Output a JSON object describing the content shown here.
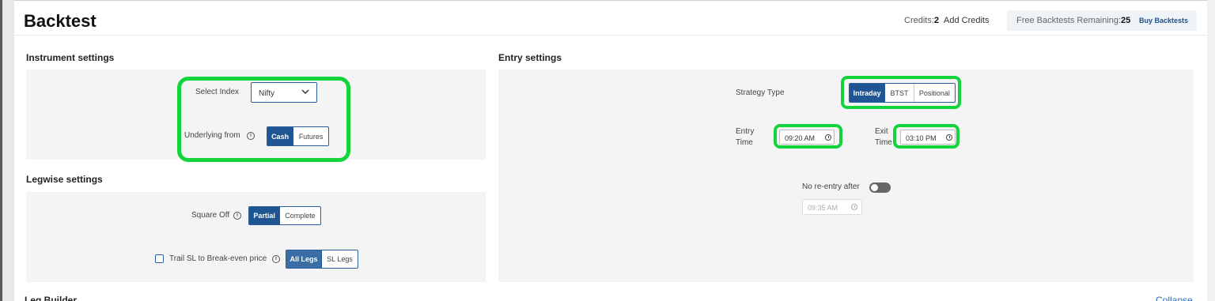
{
  "header": {
    "title": "Backtest",
    "credits_label": "Credits:",
    "credits_value": "2",
    "add_credits": "Add Credits",
    "free_backtests_label": "Free Backtests Remaining:",
    "free_backtests_count": "25",
    "buy_backtests": "Buy Backtests"
  },
  "instrument": {
    "section_title": "Instrument settings",
    "select_index_label": "Select Index",
    "select_index_value": "Nifty",
    "underlying_label": "Underlying from",
    "underlying_options": [
      "Cash",
      "Futures"
    ],
    "underlying_selected": "Cash"
  },
  "legwise": {
    "section_title": "Legwise settings",
    "square_off_label": "Square Off",
    "square_off_options": [
      "Partial",
      "Complete"
    ],
    "square_off_selected": "Partial",
    "trail_sl_label": "Trail SL to Break-even price",
    "trail_sl_checked": false,
    "trail_options": [
      "All Legs",
      "SL Legs"
    ],
    "trail_selected": "All Legs"
  },
  "entry": {
    "section_title": "Entry settings",
    "strategy_type_label": "Strategy Type",
    "strategy_options": [
      "Intraday",
      "BTST",
      "Positional"
    ],
    "strategy_selected": "Intraday",
    "entry_time_label_1": "Entry",
    "entry_time_label_2": "Time",
    "entry_time_value": "09:20 AM",
    "exit_time_label_1": "Exit",
    "exit_time_label_2": "Time",
    "exit_time_value": "03:10 PM",
    "no_reentry_label": "No re-entry after",
    "no_reentry_enabled": false,
    "no_reentry_time": "09:35 AM"
  },
  "footer": {
    "leg_builder_title": "Leg Builder",
    "collapse_label": "Collapse"
  },
  "colors": {
    "accent": "#1f5593",
    "highlight": "#14d43c",
    "panel_bg": "#f4f4f4"
  }
}
